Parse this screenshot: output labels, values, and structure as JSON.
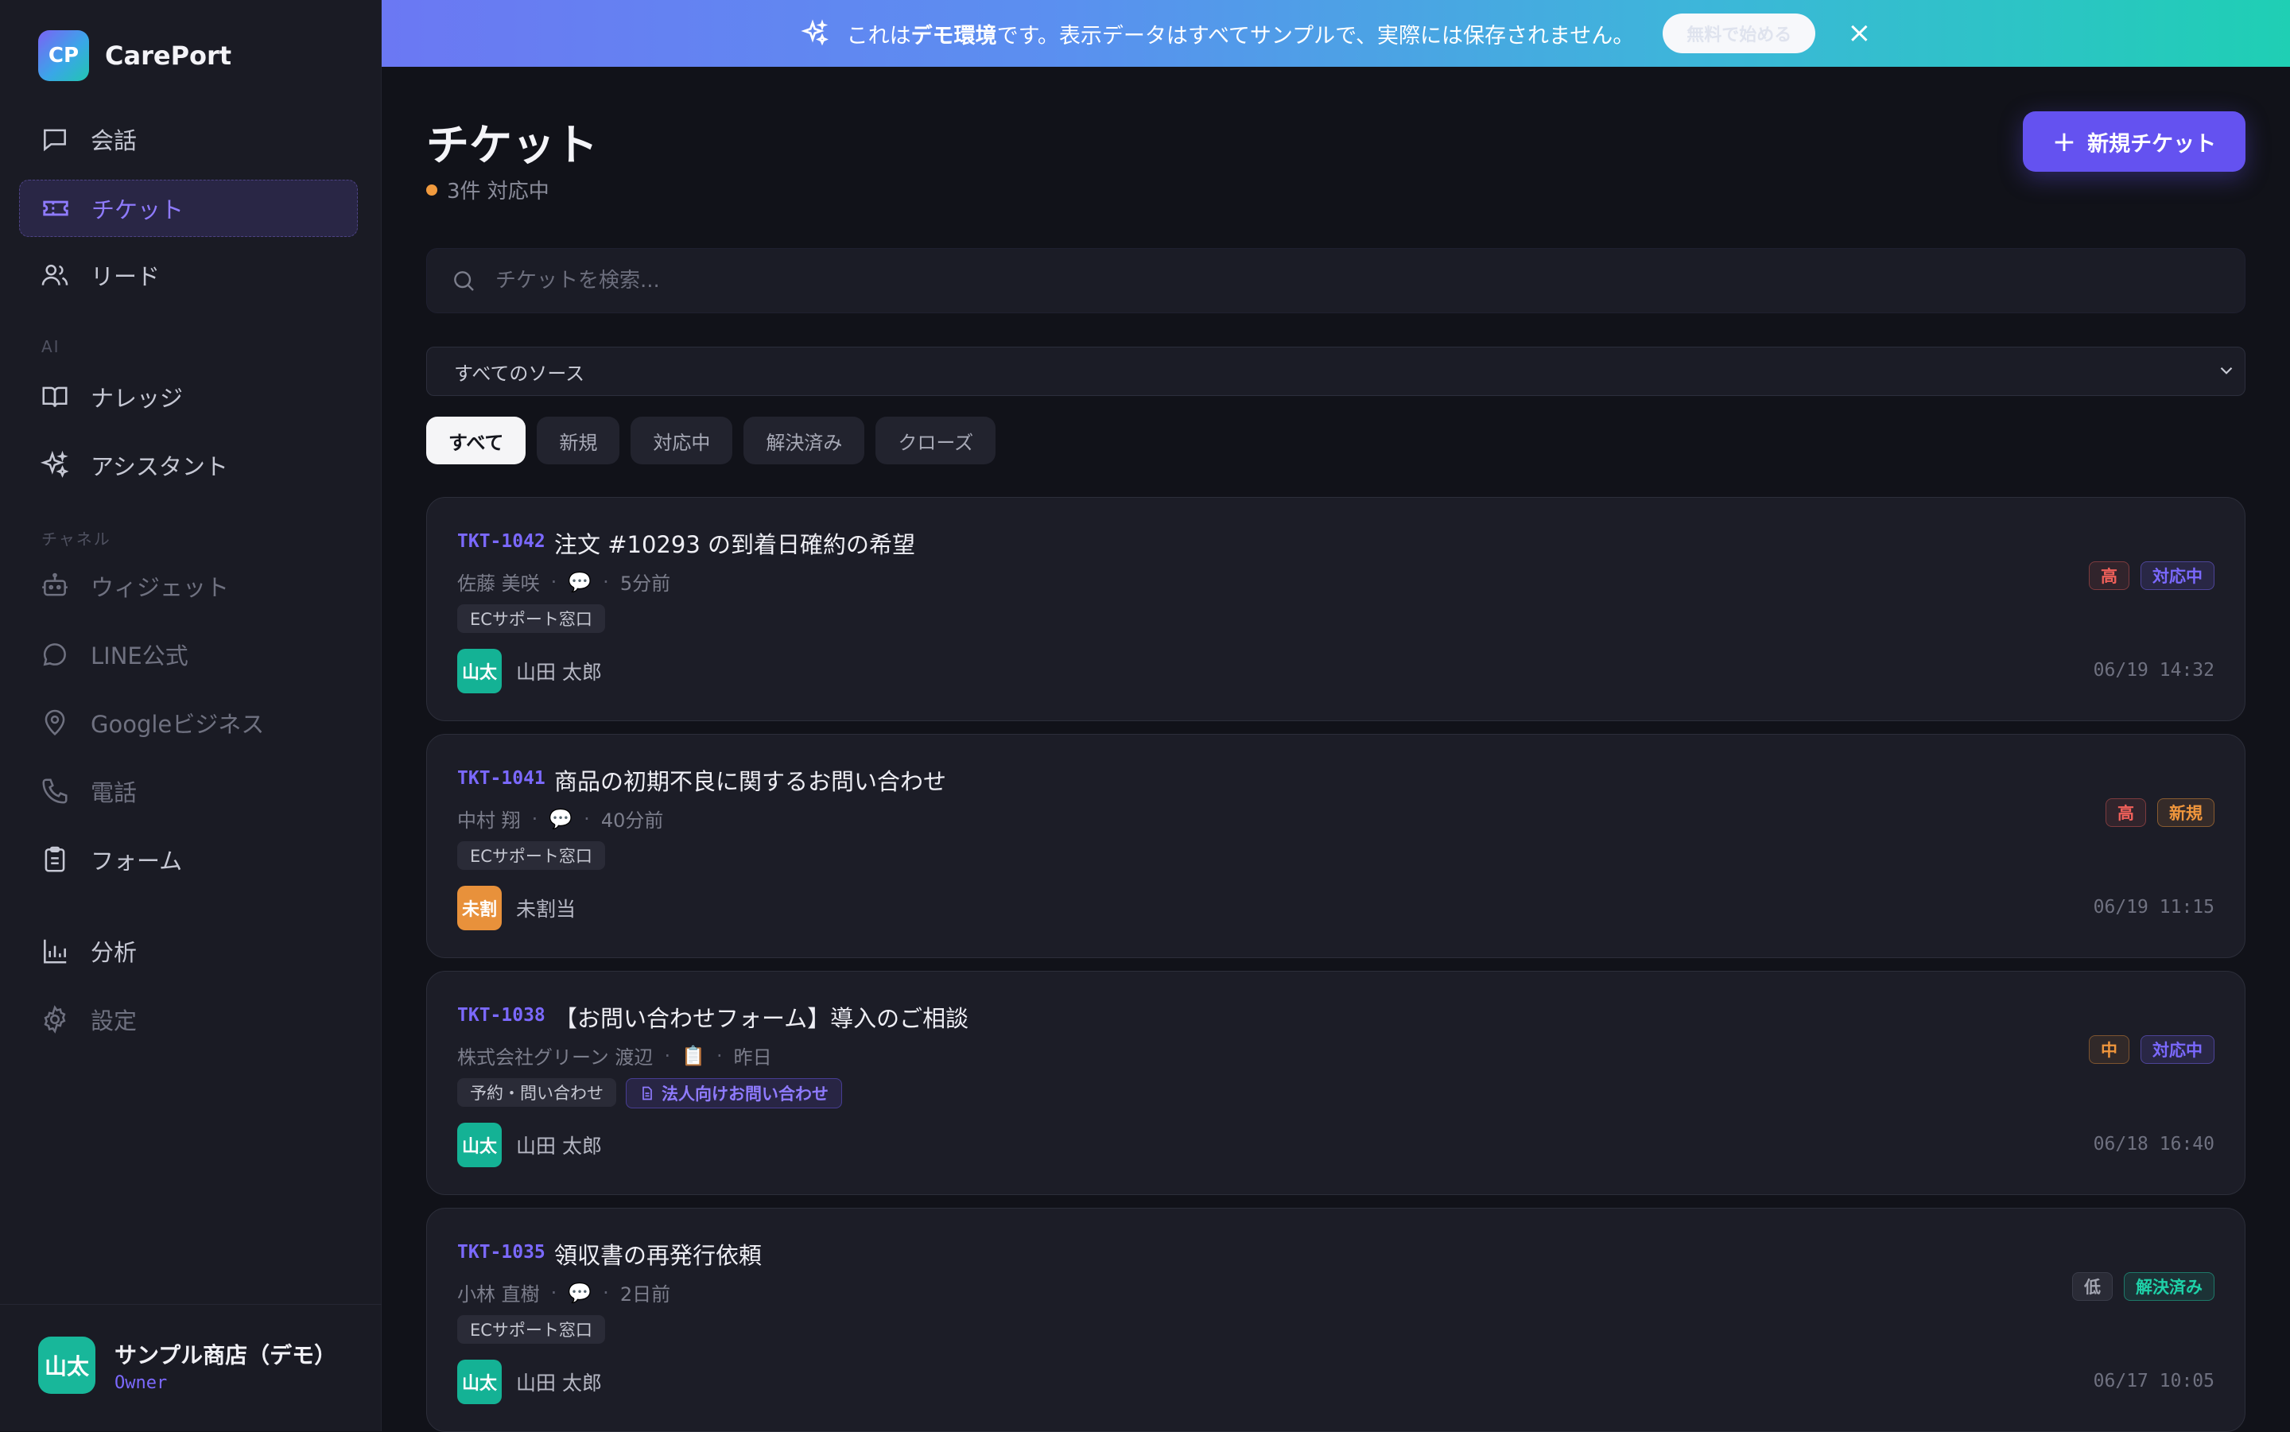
{
  "brand": {
    "logo": "CP",
    "name": "CarePort"
  },
  "sidebar": {
    "items": [
      {
        "label": "会話",
        "icon": "chat-icon"
      },
      {
        "label": "チケット",
        "icon": "ticket-icon",
        "active": true
      },
      {
        "label": "リード",
        "icon": "users-icon"
      }
    ],
    "section_ai": "AI",
    "ai_items": [
      {
        "label": "ナレッジ",
        "icon": "book-icon"
      },
      {
        "label": "アシスタント",
        "icon": "sparkle-icon"
      }
    ],
    "section_channel": "チャネル",
    "channel_items": [
      {
        "label": "ウィジェット",
        "icon": "bot-icon"
      },
      {
        "label": "LINE公式",
        "icon": "message-circle-icon"
      },
      {
        "label": "Googleビジネス",
        "icon": "map-pin-icon"
      },
      {
        "label": "電話",
        "icon": "phone-icon"
      },
      {
        "label": "フォーム",
        "icon": "clipboard-icon"
      }
    ],
    "bottom_items": [
      {
        "label": "分析",
        "icon": "bar-chart-icon"
      },
      {
        "label": "設定",
        "icon": "gear-icon"
      }
    ]
  },
  "profile": {
    "avatar": "山太",
    "name": "サンプル商店（デモ）",
    "role": "Owner"
  },
  "banner": {
    "pre": "これは",
    "strong": "デモ環境",
    "post": "です。表示データはすべてサンプルで、実際には保存されません。",
    "button": "無料で始める",
    "close": "×"
  },
  "page": {
    "title": "チケット",
    "active_count": "3件 対応中",
    "new_button": "新規チケット",
    "search_placeholder": "チケットを検索...",
    "source_select": "すべてのソース",
    "tabs": [
      "すべて",
      "新規",
      "対応中",
      "解決済み",
      "クローズ"
    ]
  },
  "tickets": [
    {
      "id": "TKT-1042",
      "title": "注文 #10293 の到着日確約の希望",
      "customer": "佐藤 美咲",
      "channel_icon": "💬",
      "ago": "5分前",
      "chips": [
        "ECサポート窓口"
      ],
      "assignee_avatar": "山太",
      "assignee": "山田 太郎",
      "priority": "高",
      "status": "対応中",
      "time": "06/19 14:32"
    },
    {
      "id": "TKT-1041",
      "title": "商品の初期不良に関するお問い合わせ",
      "customer": "中村 翔",
      "channel_icon": "💬",
      "ago": "40分前",
      "chips": [
        "ECサポート窓口"
      ],
      "assignee_avatar": "未割",
      "assignee": "未割当",
      "priority": "高",
      "status": "新規",
      "time": "06/19 11:15"
    },
    {
      "id": "TKT-1038",
      "title": "【お問い合わせフォーム】導入のご相談",
      "customer": "株式会社グリーン 渡辺",
      "channel_icon": "📋",
      "ago": "昨日",
      "chips": [
        "予約・問い合わせ"
      ],
      "form_chip": "法人向けお問い合わせ",
      "assignee_avatar": "山太",
      "assignee": "山田 太郎",
      "priority": "中",
      "status": "対応中",
      "time": "06/18 16:40"
    },
    {
      "id": "TKT-1035",
      "title": "領収書の再発行依頼",
      "customer": "小林 直樹",
      "channel_icon": "💬",
      "ago": "2日前",
      "chips": [
        "ECサポート窓口"
      ],
      "assignee_avatar": "山太",
      "assignee": "山田 太郎",
      "priority": "低",
      "status": "解決済み",
      "time": "06/17 10:05"
    }
  ]
}
